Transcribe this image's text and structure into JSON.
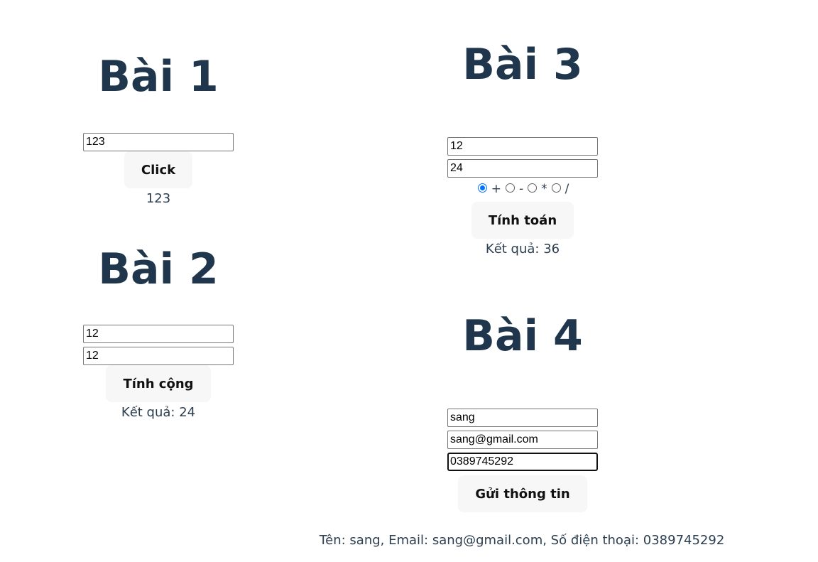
{
  "bai1": {
    "title": "Bài 1",
    "input_value": "123",
    "button_label": "Click",
    "output": "123"
  },
  "bai2": {
    "title": "Bài 2",
    "input1_value": "12",
    "input2_value": "12",
    "button_label": "Tính cộng",
    "result": "Kết quả: 24"
  },
  "bai3": {
    "title": "Bài 3",
    "input1_value": "12",
    "input2_value": "24",
    "operators": [
      "+",
      "-",
      "*",
      "/"
    ],
    "selected_operator": "+",
    "button_label": "Tính toán",
    "result": "Kết quả: 36"
  },
  "bai4": {
    "title": "Bài 4",
    "name_value": "sang",
    "email_value": "sang@gmail.com",
    "phone_value": "0389745292",
    "button_label": "Gửi thông tin",
    "summary": "Tên: sang, Email: sang@gmail.com, Số điện thoại: 0389745292"
  },
  "colors": {
    "heading": "#1f364c",
    "text": "#2c3e50",
    "button_bg": "#f7f7f7",
    "radio_accent": "#0075ff"
  }
}
